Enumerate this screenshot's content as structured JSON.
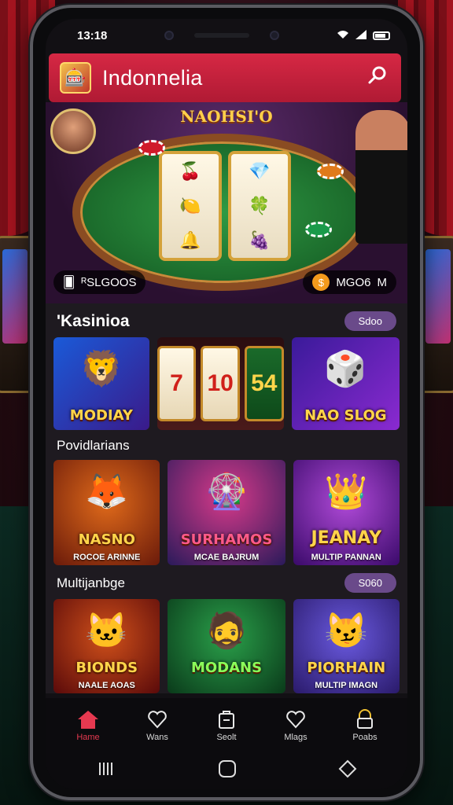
{
  "status_bar": {
    "time": "13:18"
  },
  "header": {
    "title": "Indonnelia",
    "logo_emoji": "🎰"
  },
  "hero": {
    "title": "NAOHSI'O",
    "balance_left": "ᴿSLGOOS",
    "balance_right": "MGO6",
    "balance_right_suffix": "M"
  },
  "sections": [
    {
      "title": "'Kasinioa",
      "pill": "Sdoo",
      "tiles": [
        {
          "title": "MODIAY",
          "emblem": "🦁"
        },
        {
          "reels": [
            "7",
            "10",
            "54"
          ]
        },
        {
          "title": "NAO SLOG",
          "emblem": "🎲"
        }
      ]
    },
    {
      "title": "Povidlarians",
      "tiles": [
        {
          "title": "NASNO",
          "sub": "ROCOE ARINNE",
          "emblem": "🦊"
        },
        {
          "title": "SURHAMOS",
          "sub": "MCAE BAJRUM",
          "emblem": "🎡"
        },
        {
          "title": "JEANAY",
          "sub": "MULTIP PANNAN",
          "emblem": "👑"
        }
      ]
    },
    {
      "title": "Multijanbge",
      "pill": "S060",
      "tiles": [
        {
          "title": "BIONDS",
          "sub": "NAALE AOAS",
          "emblem": "🐱"
        },
        {
          "title": "MODANS",
          "sub": "",
          "emblem": "🧔"
        },
        {
          "title": "PIORHAIN",
          "sub": "MULTIP IMAGN",
          "emblem": "😼"
        }
      ]
    }
  ],
  "bottom_nav": [
    {
      "label": "Hame",
      "icon": "home-icon",
      "active": true
    },
    {
      "label": "Wans",
      "icon": "heart-icon",
      "active": false
    },
    {
      "label": "Seolt",
      "icon": "bag-icon",
      "active": false
    },
    {
      "label": "Mlags",
      "icon": "heart-outline-icon",
      "active": false
    },
    {
      "label": "Poabs",
      "icon": "lock-icon",
      "active": false
    }
  ],
  "colors": {
    "accent": "#d62844",
    "nav_active": "#e63950",
    "pill": "#6a4a8a"
  }
}
